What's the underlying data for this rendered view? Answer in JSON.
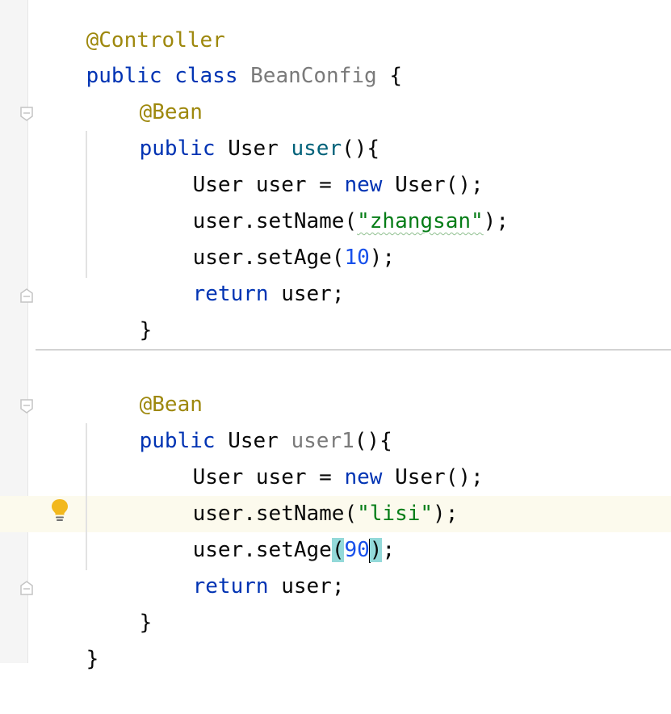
{
  "lines": {
    "l0": {
      "annotation": "@Controller"
    },
    "l1": {
      "kw1": "public",
      "kw2": "class",
      "class_name": "BeanConfig",
      "brace": "{"
    },
    "l2": {
      "annotation": "@Bean"
    },
    "l3": {
      "kw": "public",
      "type": "User",
      "method": "user",
      "rest": "(){"
    },
    "l4": {
      "pre": "User user = ",
      "kw": "new",
      "post": " User();"
    },
    "l5": {
      "pre": "user.setName(",
      "string": "\"zhangsan\"",
      "post": ");"
    },
    "l6": {
      "pre": "user.setAge(",
      "number": "10",
      "post": ");"
    },
    "l7": {
      "kw": "return",
      "post": " user;"
    },
    "l8": {
      "brace": "}"
    },
    "l9": {
      "annotation": "@Bean"
    },
    "l10": {
      "kw": "public",
      "type": "User",
      "method": "user1",
      "rest": "(){"
    },
    "l11": {
      "pre": "User user = ",
      "kw": "new",
      "post": " User();"
    },
    "l12": {
      "pre": "user.setName(",
      "string": "\"lisi\"",
      "post": ");"
    },
    "l13": {
      "pre": "user.setAge",
      "open_paren": "(",
      "number": "90",
      "close_paren": ")",
      "post": ";"
    },
    "l14": {
      "kw": "return",
      "post": " user;"
    },
    "l15": {
      "brace": "}"
    },
    "l16": {
      "brace": "}"
    }
  },
  "icons": {
    "fold": "fold-marker-icon",
    "intention": "lightbulb-icon"
  },
  "colors": {
    "keyword": "#0033b3",
    "annotation": "#9e880d",
    "string": "#067d17",
    "number": "#1750eb",
    "method_declaration": "#00627a",
    "unused": "#7a7a7a",
    "current_line": "#fcfaed",
    "brace_match": "#93d9d9"
  }
}
